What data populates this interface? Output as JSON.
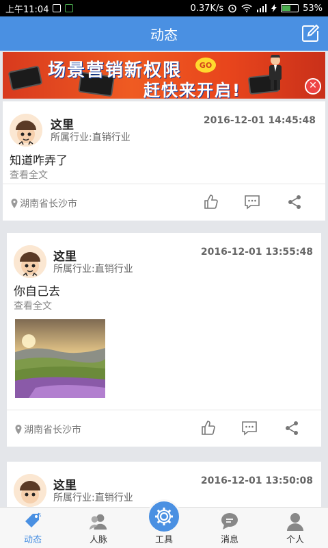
{
  "status_bar": {
    "time": "上午11:04",
    "network_speed": "0.37K/s",
    "battery": "53%",
    "battery_level": 0.53
  },
  "header": {
    "title": "动态"
  },
  "banner": {
    "line1": "场景营销新权限",
    "line2": "赶快来开启!",
    "badge": "GO"
  },
  "posts": [
    {
      "name": "这里",
      "industry": "所属行业:直销行业",
      "time": "2016-12-01 14:45:48",
      "content": "知道咋弄了",
      "more": "查看全文",
      "location": "湖南省长沙市"
    },
    {
      "name": "这里",
      "industry": "所属行业:直销行业",
      "time": "2016-12-01 13:55:48",
      "content": "你自己去",
      "more": "查看全文",
      "location": "湖南省长沙市"
    },
    {
      "name": "这里",
      "industry": "所属行业:直销行业",
      "time": "2016-12-01 13:50:08"
    }
  ],
  "tabs": [
    {
      "label": "动态",
      "icon": "tag-icon"
    },
    {
      "label": "人脉",
      "icon": "contacts-icon"
    },
    {
      "label": "工具",
      "icon": "gear-icon"
    },
    {
      "label": "消息",
      "icon": "chat-icon"
    },
    {
      "label": "个人",
      "icon": "person-icon"
    }
  ],
  "colors": {
    "primary": "#4a90e2",
    "banner": "#e8451c"
  }
}
